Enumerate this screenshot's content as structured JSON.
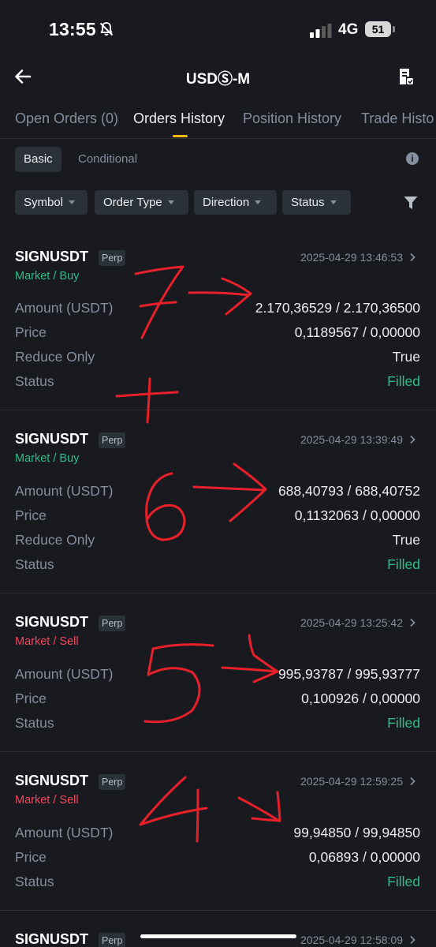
{
  "status_bar": {
    "time": "13:55",
    "network": "4G",
    "battery": "51",
    "bell_icon": "bell-muted-icon",
    "signal_icon": "signal-bars-icon"
  },
  "header": {
    "title": "USDⓈ-M",
    "back_icon": "back-arrow-icon",
    "record_icon": "document-icon"
  },
  "tabs": [
    {
      "label": "Open Orders (0)"
    },
    {
      "label": "Orders History"
    },
    {
      "label": "Position History"
    },
    {
      "label": "Trade Histo"
    }
  ],
  "subtabs": {
    "basic": "Basic",
    "conditional": "Conditional",
    "info_icon": "info-icon"
  },
  "filters": [
    {
      "label": "Symbol"
    },
    {
      "label": "Order Type"
    },
    {
      "label": "Direction"
    },
    {
      "label": "Status"
    }
  ],
  "colors": {
    "background": "#181a20",
    "buy": "#2ebd85",
    "sell": "#f6465d",
    "accent": "#f0b90b",
    "annotation": "#e8202a"
  },
  "orders": [
    {
      "symbol": "SIGNUSDT",
      "tag": "Perp",
      "date": "2025-04-29 13:46:53",
      "side": "Market / Buy",
      "rows": [
        {
          "label": "Amount (USDT)",
          "value": "2.170,36529 / 2.170,36500"
        },
        {
          "label": "Price",
          "value": "0,1189567 / 0,00000"
        },
        {
          "label": "Reduce Only",
          "value": "True"
        },
        {
          "label": "Status",
          "value": "Filled"
        }
      ]
    },
    {
      "symbol": "SIGNUSDT",
      "tag": "Perp",
      "date": "2025-04-29 13:39:49",
      "side": "Market / Buy",
      "rows": [
        {
          "label": "Amount (USDT)",
          "value": "688,40793 / 688,40752"
        },
        {
          "label": "Price",
          "value": "0,1132063 / 0,00000"
        },
        {
          "label": "Reduce Only",
          "value": "True"
        },
        {
          "label": "Status",
          "value": "Filled"
        }
      ]
    },
    {
      "symbol": "SIGNUSDT",
      "tag": "Perp",
      "date": "2025-04-29 13:25:42",
      "side": "Market / Sell",
      "rows": [
        {
          "label": "Amount (USDT)",
          "value": "995,93787 / 995,93777"
        },
        {
          "label": "Price",
          "value": "0,100926 / 0,00000"
        },
        {
          "label": "Status",
          "value": "Filled"
        }
      ]
    },
    {
      "symbol": "SIGNUSDT",
      "tag": "Perp",
      "date": "2025-04-29 12:59:25",
      "side": "Market / Sell",
      "rows": [
        {
          "label": "Amount (USDT)",
          "value": "99,94850 / 99,94850"
        },
        {
          "label": "Price",
          "value": "0,06893 / 0,00000"
        },
        {
          "label": "Status",
          "value": "Filled"
        }
      ]
    },
    {
      "symbol": "SIGNUSDT",
      "tag": "Perp",
      "date": "2025-04-29 12:58:09",
      "side": "",
      "rows": []
    }
  ]
}
